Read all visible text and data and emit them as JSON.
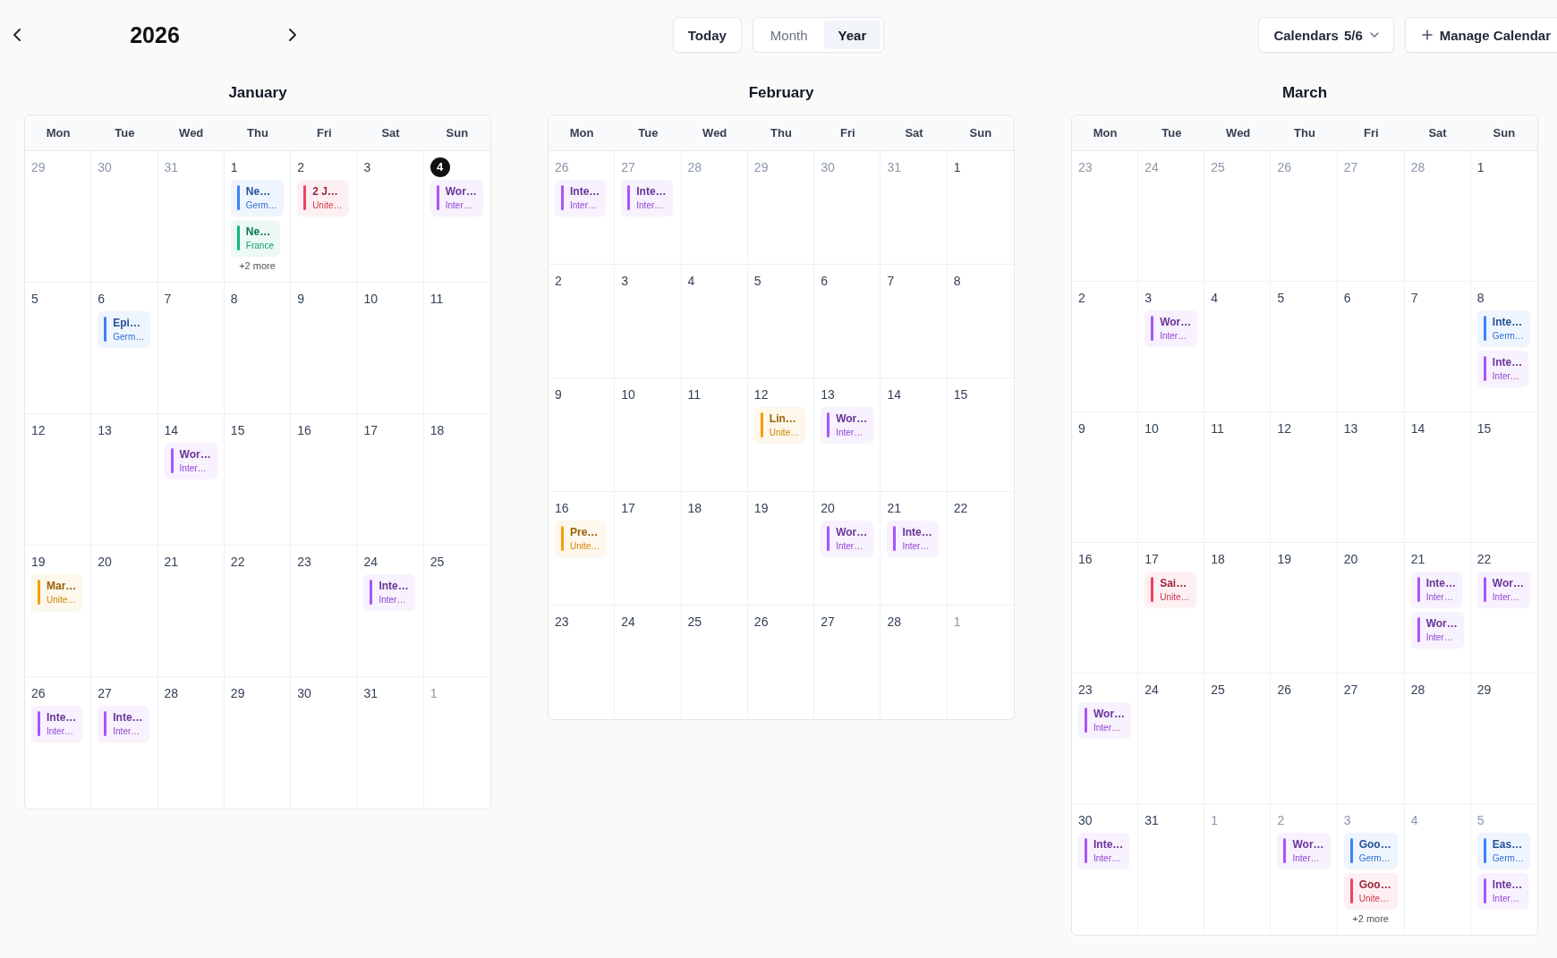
{
  "header": {
    "title": "2026",
    "today_button": "Today",
    "views": [
      {
        "label": "Month",
        "selected": false
      },
      {
        "label": "Year",
        "selected": true
      }
    ],
    "calendars_button": {
      "label": "Calendars",
      "count": "5/6"
    },
    "manage_button": "Manage Calendar"
  },
  "months": [
    {
      "name": "January",
      "weekdays": [
        "Mon",
        "Tue",
        "Wed",
        "Thu",
        "Fri",
        "Sat",
        "Sun"
      ],
      "weeks": [
        [
          {
            "day": "29",
            "outside": true,
            "today": false
          },
          {
            "day": "30",
            "outside": true,
            "today": false
          },
          {
            "day": "31",
            "outside": true,
            "today": false
          },
          {
            "day": "1",
            "outside": false,
            "today": false,
            "events": [
              {
                "title": "Ne…",
                "calendar": "Germ…",
                "color": "#3b82f6"
              },
              {
                "title": "Ne…",
                "calendar": "France",
                "color": "#10b981"
              }
            ],
            "more": "+2 more"
          },
          {
            "day": "2",
            "outside": false,
            "today": false,
            "events": [
              {
                "title": "2 J…",
                "calendar": "Unite…",
                "color": "#f43f5e"
              }
            ]
          },
          {
            "day": "3",
            "outside": false,
            "today": false
          },
          {
            "day": "4",
            "outside": false,
            "today": true,
            "events": [
              {
                "title": "Wor…",
                "calendar": "Inter…",
                "color": "#a855f7"
              }
            ]
          }
        ],
        [
          {
            "day": "5",
            "outside": false,
            "today": false
          },
          {
            "day": "6",
            "outside": false,
            "today": false,
            "events": [
              {
                "title": "Epi…",
                "calendar": "Germ…",
                "color": "#3b82f6"
              }
            ]
          },
          {
            "day": "7",
            "outside": false,
            "today": false
          },
          {
            "day": "8",
            "outside": false,
            "today": false
          },
          {
            "day": "9",
            "outside": false,
            "today": false
          },
          {
            "day": "10",
            "outside": false,
            "today": false
          },
          {
            "day": "11",
            "outside": false,
            "today": false
          }
        ],
        [
          {
            "day": "12",
            "outside": false,
            "today": false
          },
          {
            "day": "13",
            "outside": false,
            "today": false
          },
          {
            "day": "14",
            "outside": false,
            "today": false,
            "events": [
              {
                "title": "Wor…",
                "calendar": "Inter…",
                "color": "#a855f7"
              }
            ]
          },
          {
            "day": "15",
            "outside": false,
            "today": false
          },
          {
            "day": "16",
            "outside": false,
            "today": false
          },
          {
            "day": "17",
            "outside": false,
            "today": false
          },
          {
            "day": "18",
            "outside": false,
            "today": false
          }
        ],
        [
          {
            "day": "19",
            "outside": false,
            "today": false,
            "events": [
              {
                "title": "Mar…",
                "calendar": "Unite…",
                "color": "#f59e0b"
              }
            ]
          },
          {
            "day": "20",
            "outside": false,
            "today": false
          },
          {
            "day": "21",
            "outside": false,
            "today": false
          },
          {
            "day": "22",
            "outside": false,
            "today": false
          },
          {
            "day": "23",
            "outside": false,
            "today": false
          },
          {
            "day": "24",
            "outside": false,
            "today": false,
            "events": [
              {
                "title": "Inte…",
                "calendar": "Inter…",
                "color": "#a855f7"
              }
            ]
          },
          {
            "day": "25",
            "outside": false,
            "today": false
          }
        ],
        [
          {
            "day": "26",
            "outside": false,
            "today": false,
            "events": [
              {
                "title": "Inte…",
                "calendar": "Inter…",
                "color": "#a855f7"
              }
            ]
          },
          {
            "day": "27",
            "outside": false,
            "today": false,
            "events": [
              {
                "title": "Inte…",
                "calendar": "Inter…",
                "color": "#a855f7"
              }
            ]
          },
          {
            "day": "28",
            "outside": false,
            "today": false
          },
          {
            "day": "29",
            "outside": false,
            "today": false
          },
          {
            "day": "30",
            "outside": false,
            "today": false
          },
          {
            "day": "31",
            "outside": false,
            "today": false
          },
          {
            "day": "1",
            "outside": true,
            "today": false
          }
        ]
      ]
    },
    {
      "name": "February",
      "weekdays": [
        "Mon",
        "Tue",
        "Wed",
        "Thu",
        "Fri",
        "Sat",
        "Sun"
      ],
      "weeks": [
        [
          {
            "day": "26",
            "outside": true,
            "today": false,
            "events": [
              {
                "title": "Inte…",
                "calendar": "Inter…",
                "color": "#a855f7"
              }
            ]
          },
          {
            "day": "27",
            "outside": true,
            "today": false,
            "events": [
              {
                "title": "Inte…",
                "calendar": "Inter…",
                "color": "#a855f7"
              }
            ]
          },
          {
            "day": "28",
            "outside": true,
            "today": false
          },
          {
            "day": "29",
            "outside": true,
            "today": false
          },
          {
            "day": "30",
            "outside": true,
            "today": false
          },
          {
            "day": "31",
            "outside": true,
            "today": false
          },
          {
            "day": "1",
            "outside": false,
            "today": false
          }
        ],
        [
          {
            "day": "2",
            "outside": false,
            "today": false
          },
          {
            "day": "3",
            "outside": false,
            "today": false
          },
          {
            "day": "4",
            "outside": false,
            "today": false
          },
          {
            "day": "5",
            "outside": false,
            "today": false
          },
          {
            "day": "6",
            "outside": false,
            "today": false
          },
          {
            "day": "7",
            "outside": false,
            "today": false
          },
          {
            "day": "8",
            "outside": false,
            "today": false
          }
        ],
        [
          {
            "day": "9",
            "outside": false,
            "today": false
          },
          {
            "day": "10",
            "outside": false,
            "today": false
          },
          {
            "day": "11",
            "outside": false,
            "today": false
          },
          {
            "day": "12",
            "outside": false,
            "today": false,
            "events": [
              {
                "title": "Lin…",
                "calendar": "Unite…",
                "color": "#f59e0b"
              }
            ]
          },
          {
            "day": "13",
            "outside": false,
            "today": false,
            "events": [
              {
                "title": "Wor…",
                "calendar": "Inter…",
                "color": "#a855f7"
              }
            ]
          },
          {
            "day": "14",
            "outside": false,
            "today": false
          },
          {
            "day": "15",
            "outside": false,
            "today": false
          }
        ],
        [
          {
            "day": "16",
            "outside": false,
            "today": false,
            "events": [
              {
                "title": "Pre…",
                "calendar": "Unite…",
                "color": "#f59e0b"
              }
            ]
          },
          {
            "day": "17",
            "outside": false,
            "today": false
          },
          {
            "day": "18",
            "outside": false,
            "today": false
          },
          {
            "day": "19",
            "outside": false,
            "today": false
          },
          {
            "day": "20",
            "outside": false,
            "today": false,
            "events": [
              {
                "title": "Wor…",
                "calendar": "Inter…",
                "color": "#a855f7"
              }
            ]
          },
          {
            "day": "21",
            "outside": false,
            "today": false,
            "events": [
              {
                "title": "Inte…",
                "calendar": "Inter…",
                "color": "#a855f7"
              }
            ]
          },
          {
            "day": "22",
            "outside": false,
            "today": false
          }
        ],
        [
          {
            "day": "23",
            "outside": false,
            "today": false
          },
          {
            "day": "24",
            "outside": false,
            "today": false
          },
          {
            "day": "25",
            "outside": false,
            "today": false
          },
          {
            "day": "26",
            "outside": false,
            "today": false
          },
          {
            "day": "27",
            "outside": false,
            "today": false
          },
          {
            "day": "28",
            "outside": false,
            "today": false
          },
          {
            "day": "1",
            "outside": true,
            "today": false
          }
        ]
      ]
    },
    {
      "name": "March",
      "weekdays": [
        "Mon",
        "Tue",
        "Wed",
        "Thu",
        "Fri",
        "Sat",
        "Sun"
      ],
      "weeks": [
        [
          {
            "day": "23",
            "outside": true,
            "today": false
          },
          {
            "day": "24",
            "outside": true,
            "today": false
          },
          {
            "day": "25",
            "outside": true,
            "today": false
          },
          {
            "day": "26",
            "outside": true,
            "today": false
          },
          {
            "day": "27",
            "outside": true,
            "today": false
          },
          {
            "day": "28",
            "outside": true,
            "today": false
          },
          {
            "day": "1",
            "outside": false,
            "today": false
          }
        ],
        [
          {
            "day": "2",
            "outside": false,
            "today": false
          },
          {
            "day": "3",
            "outside": false,
            "today": false,
            "events": [
              {
                "title": "Wor…",
                "calendar": "Inter…",
                "color": "#a855f7"
              }
            ]
          },
          {
            "day": "4",
            "outside": false,
            "today": false
          },
          {
            "day": "5",
            "outside": false,
            "today": false
          },
          {
            "day": "6",
            "outside": false,
            "today": false
          },
          {
            "day": "7",
            "outside": false,
            "today": false
          },
          {
            "day": "8",
            "outside": false,
            "today": false,
            "events": [
              {
                "title": "Inte…",
                "calendar": "Germ…",
                "color": "#3b82f6"
              },
              {
                "title": "Inte…",
                "calendar": "Inter…",
                "color": "#a855f7"
              }
            ]
          }
        ],
        [
          {
            "day": "9",
            "outside": false,
            "today": false
          },
          {
            "day": "10",
            "outside": false,
            "today": false
          },
          {
            "day": "11",
            "outside": false,
            "today": false
          },
          {
            "day": "12",
            "outside": false,
            "today": false
          },
          {
            "day": "13",
            "outside": false,
            "today": false
          },
          {
            "day": "14",
            "outside": false,
            "today": false
          },
          {
            "day": "15",
            "outside": false,
            "today": false
          }
        ],
        [
          {
            "day": "16",
            "outside": false,
            "today": false
          },
          {
            "day": "17",
            "outside": false,
            "today": false,
            "events": [
              {
                "title": "Sai…",
                "calendar": "Unite…",
                "color": "#f43f5e"
              }
            ]
          },
          {
            "day": "18",
            "outside": false,
            "today": false
          },
          {
            "day": "19",
            "outside": false,
            "today": false
          },
          {
            "day": "20",
            "outside": false,
            "today": false
          },
          {
            "day": "21",
            "outside": false,
            "today": false,
            "events": [
              {
                "title": "Inte…",
                "calendar": "Inter…",
                "color": "#a855f7"
              },
              {
                "title": "Wor…",
                "calendar": "Inter…",
                "color": "#a855f7"
              }
            ]
          },
          {
            "day": "22",
            "outside": false,
            "today": false,
            "events": [
              {
                "title": "Wor…",
                "calendar": "Inter…",
                "color": "#a855f7"
              }
            ]
          }
        ],
        [
          {
            "day": "23",
            "outside": false,
            "today": false,
            "events": [
              {
                "title": "Wor…",
                "calendar": "Inter…",
                "color": "#a855f7"
              }
            ]
          },
          {
            "day": "24",
            "outside": false,
            "today": false
          },
          {
            "day": "25",
            "outside": false,
            "today": false
          },
          {
            "day": "26",
            "outside": false,
            "today": false
          },
          {
            "day": "27",
            "outside": false,
            "today": false
          },
          {
            "day": "28",
            "outside": false,
            "today": false
          },
          {
            "day": "29",
            "outside": false,
            "today": false
          }
        ],
        [
          {
            "day": "30",
            "outside": false,
            "today": false,
            "events": [
              {
                "title": "Inte…",
                "calendar": "Inter…",
                "color": "#a855f7"
              }
            ]
          },
          {
            "day": "31",
            "outside": false,
            "today": false
          },
          {
            "day": "1",
            "outside": true,
            "today": false
          },
          {
            "day": "2",
            "outside": true,
            "today": false,
            "events": [
              {
                "title": "Wor…",
                "calendar": "Inter…",
                "color": "#a855f7"
              }
            ]
          },
          {
            "day": "3",
            "outside": true,
            "today": false,
            "events": [
              {
                "title": "Goo…",
                "calendar": "Germ…",
                "color": "#3b82f6"
              },
              {
                "title": "Goo…",
                "calendar": "Unite…",
                "color": "#f43f5e"
              }
            ],
            "more": "+2 more"
          },
          {
            "day": "4",
            "outside": true,
            "today": false
          },
          {
            "day": "5",
            "outside": true,
            "today": false,
            "events": [
              {
                "title": "Eas…",
                "calendar": "Germ…",
                "color": "#3b82f6"
              },
              {
                "title": "Inte…",
                "calendar": "Inter…",
                "color": "#a855f7"
              }
            ]
          }
        ]
      ]
    }
  ]
}
